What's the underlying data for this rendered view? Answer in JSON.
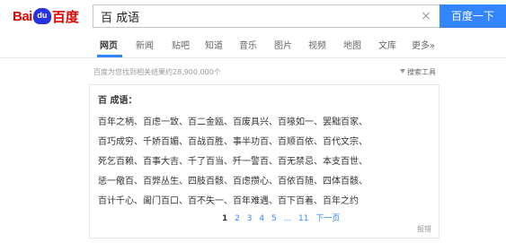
{
  "header": {
    "logo_text_left": "Bai",
    "logo_paw_text": "du",
    "logo_text_right": "百度",
    "search_value": "百 成语",
    "clear_symbol": "×",
    "search_button": "百度一下"
  },
  "tabs": [
    {
      "label": "网页",
      "active": true
    },
    {
      "label": "新闻",
      "active": false
    },
    {
      "label": "贴吧",
      "active": false
    },
    {
      "label": "知道",
      "active": false
    },
    {
      "label": "音乐",
      "active": false
    },
    {
      "label": "图片",
      "active": false
    },
    {
      "label": "视频",
      "active": false
    },
    {
      "label": "地图",
      "active": false
    },
    {
      "label": "文库",
      "active": false
    },
    {
      "label": "更多»",
      "active": false
    }
  ],
  "result_count": "百度为您找到相关结果约28,900,000个",
  "tools_label": "搜索工具",
  "card": {
    "title": "百 成语：",
    "rows": [
      "百年之柄、百虑一致、百二金瓯、百废具兴、百喙如一、罢黜百家、",
      "百巧成穷、千娇百媚、百战百胜、事半功百、百顺百依、百代文宗、",
      "死乞百赖、百事大吉、千了百当、歼一警百、百无禁忌、本支百世、",
      "惩一儆百、百弊丛生、四肢百骸、百虑攒心、百依百随、四体百骸、",
      "百计千心、阖门百口、百不失一、百年难遇、百下百着、百年之约"
    ],
    "pager": [
      "1",
      "2",
      "3",
      "4",
      "5",
      "...",
      "11",
      "下一页"
    ],
    "feedback": "报错"
  },
  "colors": {
    "brand_red": "#e10602",
    "brand_blue": "#2932e1",
    "button_blue": "#3385ff"
  }
}
